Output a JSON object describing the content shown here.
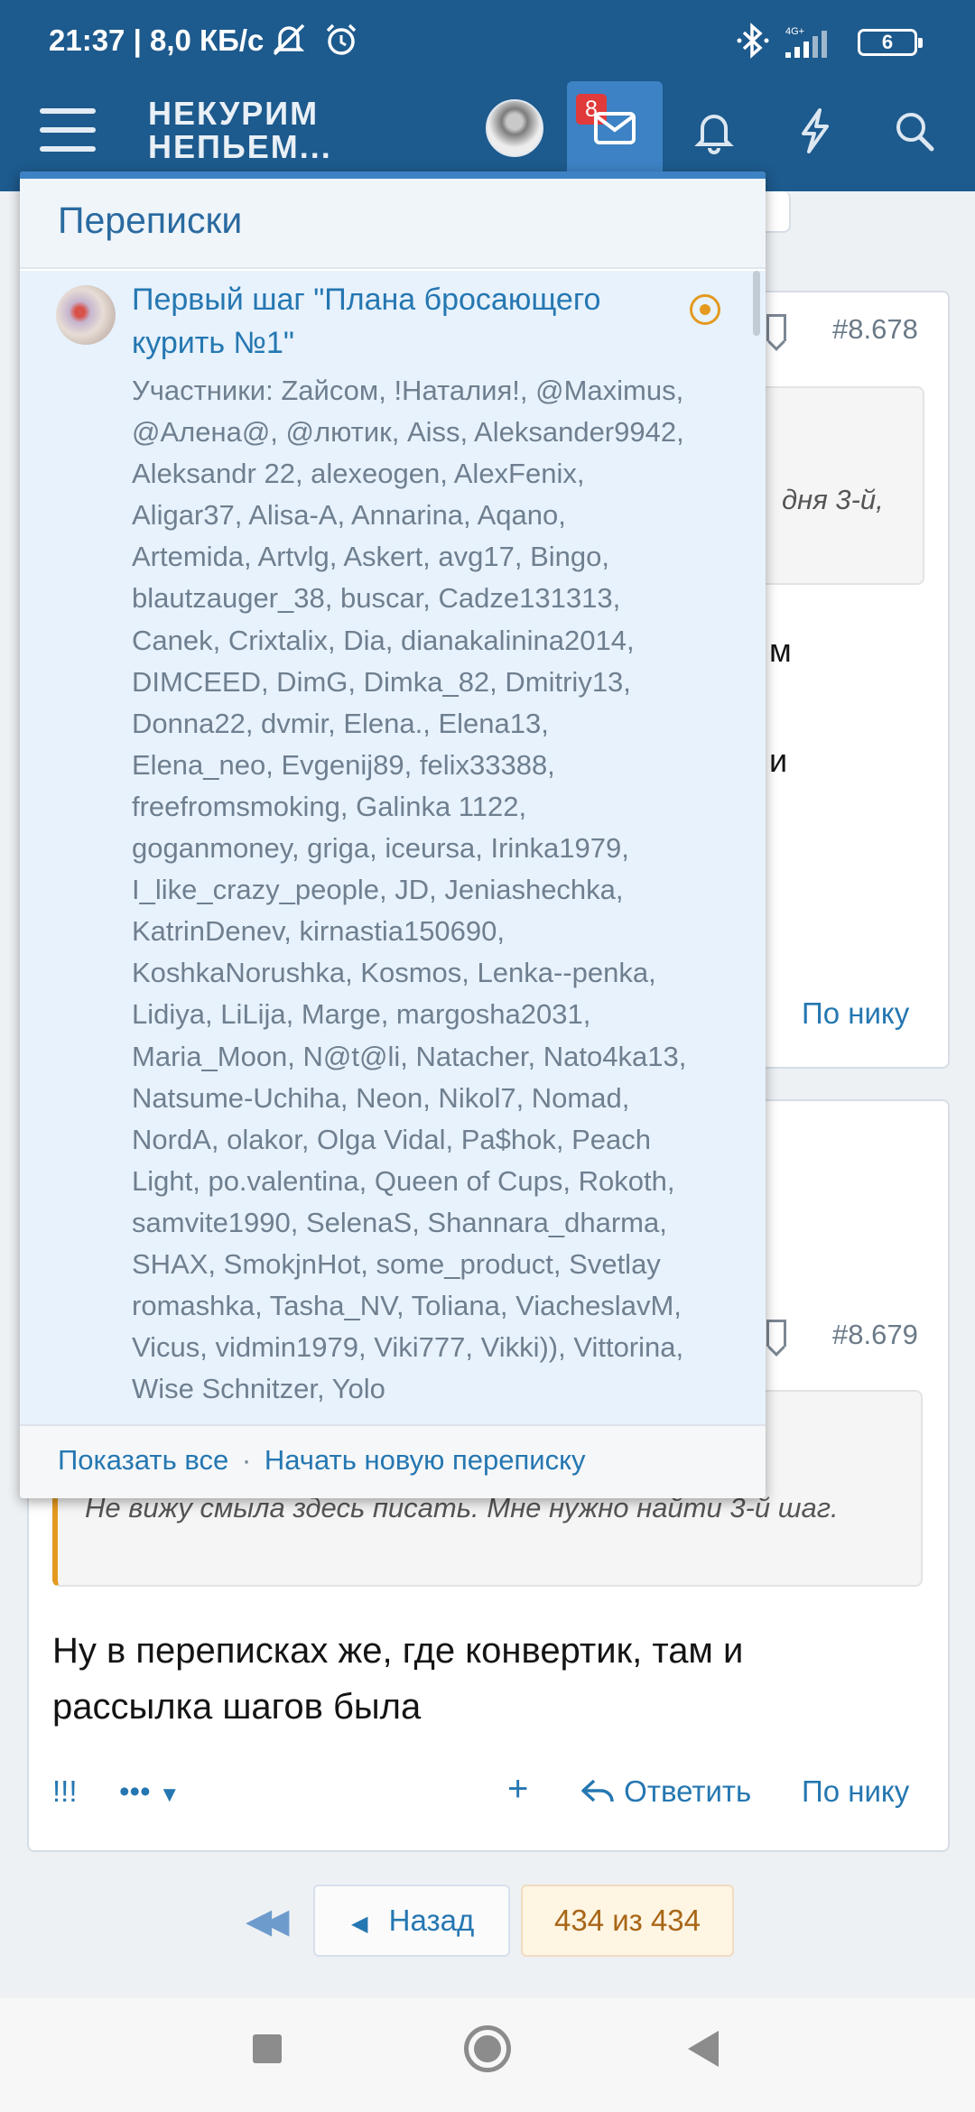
{
  "status_bar": {
    "time": "21:37 | 8,0 КБ/с",
    "network": "4G+",
    "battery": "6"
  },
  "header": {
    "logo_line1": "НЕКУРИМ",
    "logo_line2": "НЕПЬЕМ...",
    "mail_badge": "8"
  },
  "popup": {
    "title": "Переписки",
    "conversation": {
      "title": "Первый шаг \"Плана бросающего курить №1\"",
      "participants": "Участники: Zайсом, !Наталия!, @Maximus, @Алена@, @лютик, Aiss, Aleksander9942, Aleksandr 22, alexeogen, AlexFenix, Aligar37, Alisa-A, Annarina, Aqano, Artemida, Artvlg, Askert, avg17, Bingo, blautzauger_38, buscar, Cadze131313, Canek, Crixtalix, Dia, dianakalinina2014, DIMCEED, DimG, Dimka_82, Dmitriy13, Donna22, dvmir, Elena., Elena13, Elena_neo, Evgenij89, felix33388, freefromsmoking, Galinka 1122, goganmoney, griga, iceursa, Irinka1979, I_like_crazy_people, JD, Jeniashechka, KatrinDenev, kirnastia150690, KoshkaNorushka, Kosmos, Lenka--penka, Lidiya, LiLija, Marge, margosha2031, Maria_Moon, N@t@li, Natacher, Nato4ka13, Natsume-Uchiha, Neon, Nikol7, Nomad, NordA, olakor, Olga Vidal, Pa$hok, Peach Light, po.valentina, Queen of Cups, Rokoth, samvite1990, SelenaS, Shannara_dharma, SHAX, SmokjnHot, some_product, Svetlay romashka, Tasha_NV, Toliana, ViacheslavM, Vicus, vidmin1979, Viki777, Vikki)), Vittorina, Wise Schnitzer, Yolo"
    },
    "footer": {
      "show_all": "Показать все",
      "separator": "·",
      "new_conversation": "Начать новую переписку"
    }
  },
  "background": {
    "post1_number": "#8.678",
    "quote1_fragment": "дня 3-й,",
    "text_fragment1": "м",
    "text_fragment2": "и",
    "by_nick_label": "По нику",
    "post2_number": "#8.679",
    "quote2_text": "Не вижу смыла здесь писать. Мне нужно найти 3-й шаг.",
    "post2_text": "Ну в переписках же, где конвертик, там и рассылка шагов была",
    "exclaim_label": "!!!",
    "more_label": "•••",
    "plus_label": "+",
    "reply_label": "Ответить",
    "by_nick_label2": "По нику"
  },
  "pagination": {
    "first_icon": "◀◀",
    "prev_label": "Назад",
    "current": "434 из 434"
  },
  "colors": {
    "header_bg": "#1d5a8d",
    "accent": "#3d82c4",
    "link": "#2577b1",
    "badge": "#e03a3a",
    "unread": "#e49a1f"
  }
}
